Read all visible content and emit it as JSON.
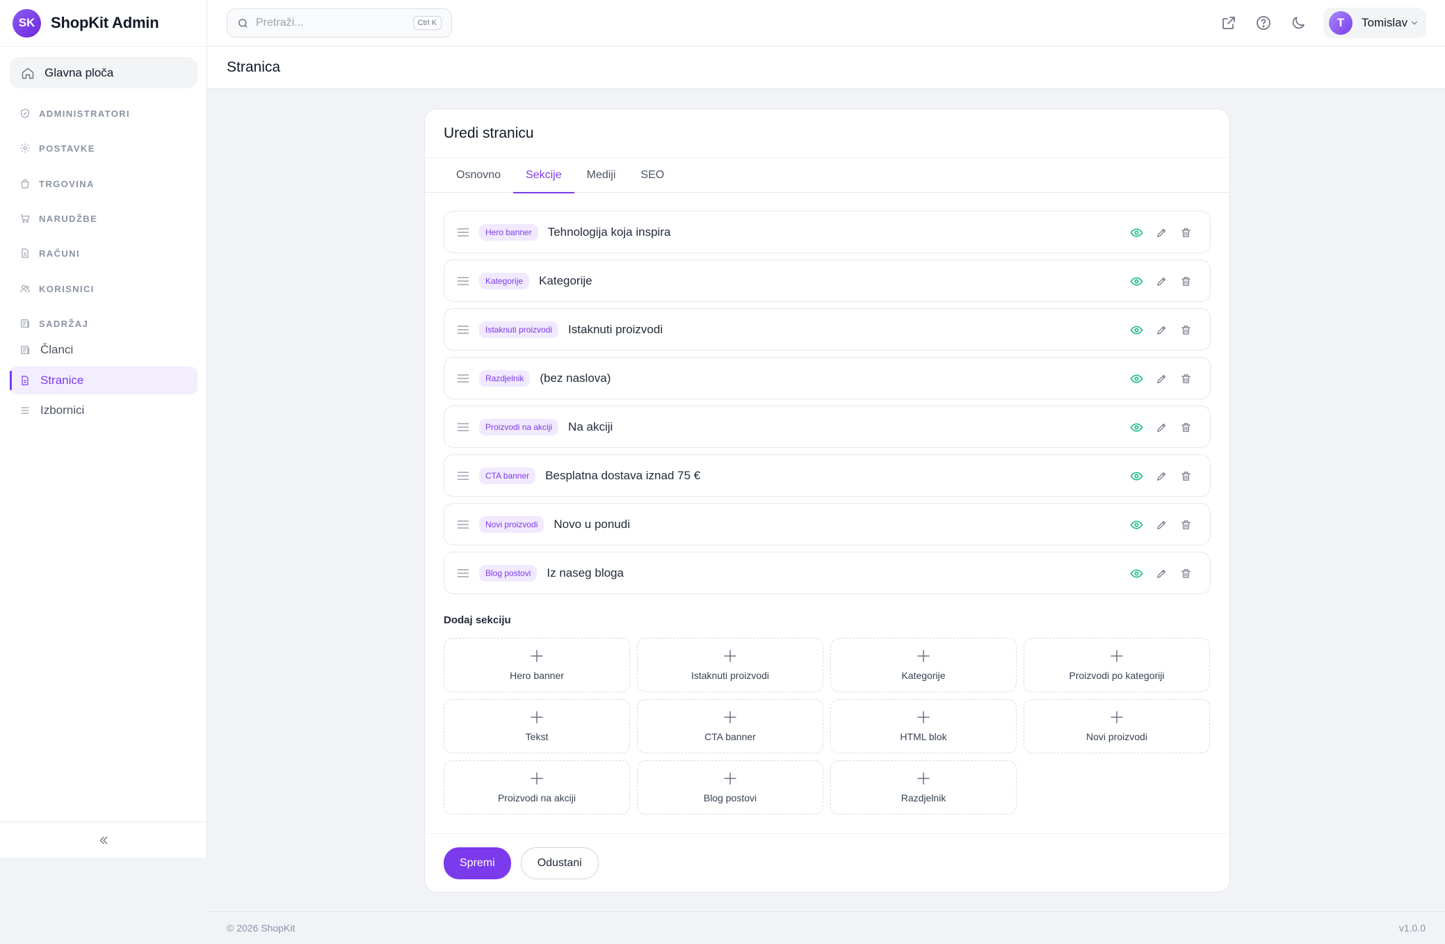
{
  "brand": {
    "initials": "SK",
    "name": "ShopKit Admin"
  },
  "sidebar": {
    "dashboard": "Glavna ploča",
    "sections": [
      "ADMINISTRATORI",
      "POSTAVKE",
      "TRGOVINA",
      "NARUDŽBE",
      "RAČUNI",
      "KORISNICI",
      "SADRŽAJ"
    ],
    "content_items": [
      {
        "label": "Članci",
        "active": false
      },
      {
        "label": "Stranice",
        "active": true
      },
      {
        "label": "Izbornici",
        "active": false
      }
    ]
  },
  "topbar": {
    "search_placeholder": "Pretraži...",
    "shortcut": "Ctrl K",
    "user": {
      "initial": "T",
      "name": "Tomislav"
    }
  },
  "page": {
    "title": "Stranica"
  },
  "card": {
    "title": "Uredi stranicu",
    "tabs": [
      {
        "label": "Osnovno",
        "active": false
      },
      {
        "label": "Sekcije",
        "active": true
      },
      {
        "label": "Mediji",
        "active": false
      },
      {
        "label": "SEO",
        "active": false
      }
    ],
    "sections": [
      {
        "type": "Hero banner",
        "title": "Tehnologija koja inspira"
      },
      {
        "type": "Kategorije",
        "title": "Kategorije"
      },
      {
        "type": "Istaknuti proizvodi",
        "title": "Istaknuti proizvodi"
      },
      {
        "type": "Razdjelnik",
        "title": "(bez naslova)"
      },
      {
        "type": "Proizvodi na akciji",
        "title": "Na akciji"
      },
      {
        "type": "CTA banner",
        "title": "Besplatna dostava iznad 75 €"
      },
      {
        "type": "Novi proizvodi",
        "title": "Novo u ponudi"
      },
      {
        "type": "Blog postovi",
        "title": "Iz naseg bloga"
      }
    ],
    "add_section_title": "Dodaj sekciju",
    "add_options": [
      "Hero banner",
      "Istaknuti proizvodi",
      "Kategorije",
      "Proizvodi po kategoriji",
      "Tekst",
      "CTA banner",
      "HTML blok",
      "Novi proizvodi",
      "Proizvodi na akciji",
      "Blog postovi",
      "Razdjelnik"
    ],
    "save_label": "Spremi",
    "cancel_label": "Odustani"
  },
  "colors": {
    "accent": "#7c3aed",
    "visible": "#10b981"
  },
  "footer": {
    "copyright": "© 2026 ShopKit",
    "version": "v1.0.0"
  }
}
